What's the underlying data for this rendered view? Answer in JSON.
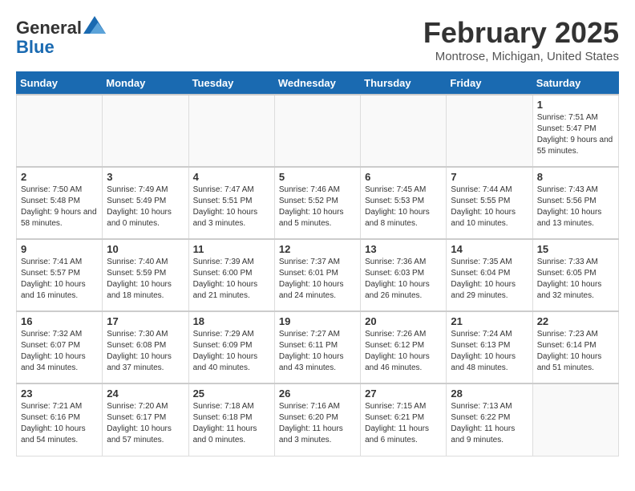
{
  "logo": {
    "general": "General",
    "blue": "Blue"
  },
  "header": {
    "title": "February 2025",
    "subtitle": "Montrose, Michigan, United States"
  },
  "days_of_week": [
    "Sunday",
    "Monday",
    "Tuesday",
    "Wednesday",
    "Thursday",
    "Friday",
    "Saturday"
  ],
  "weeks": [
    [
      {
        "day": "",
        "info": ""
      },
      {
        "day": "",
        "info": ""
      },
      {
        "day": "",
        "info": ""
      },
      {
        "day": "",
        "info": ""
      },
      {
        "day": "",
        "info": ""
      },
      {
        "day": "",
        "info": ""
      },
      {
        "day": "1",
        "info": "Sunrise: 7:51 AM\nSunset: 5:47 PM\nDaylight: 9 hours and 55 minutes."
      }
    ],
    [
      {
        "day": "2",
        "info": "Sunrise: 7:50 AM\nSunset: 5:48 PM\nDaylight: 9 hours and 58 minutes."
      },
      {
        "day": "3",
        "info": "Sunrise: 7:49 AM\nSunset: 5:49 PM\nDaylight: 10 hours and 0 minutes."
      },
      {
        "day": "4",
        "info": "Sunrise: 7:47 AM\nSunset: 5:51 PM\nDaylight: 10 hours and 3 minutes."
      },
      {
        "day": "5",
        "info": "Sunrise: 7:46 AM\nSunset: 5:52 PM\nDaylight: 10 hours and 5 minutes."
      },
      {
        "day": "6",
        "info": "Sunrise: 7:45 AM\nSunset: 5:53 PM\nDaylight: 10 hours and 8 minutes."
      },
      {
        "day": "7",
        "info": "Sunrise: 7:44 AM\nSunset: 5:55 PM\nDaylight: 10 hours and 10 minutes."
      },
      {
        "day": "8",
        "info": "Sunrise: 7:43 AM\nSunset: 5:56 PM\nDaylight: 10 hours and 13 minutes."
      }
    ],
    [
      {
        "day": "9",
        "info": "Sunrise: 7:41 AM\nSunset: 5:57 PM\nDaylight: 10 hours and 16 minutes."
      },
      {
        "day": "10",
        "info": "Sunrise: 7:40 AM\nSunset: 5:59 PM\nDaylight: 10 hours and 18 minutes."
      },
      {
        "day": "11",
        "info": "Sunrise: 7:39 AM\nSunset: 6:00 PM\nDaylight: 10 hours and 21 minutes."
      },
      {
        "day": "12",
        "info": "Sunrise: 7:37 AM\nSunset: 6:01 PM\nDaylight: 10 hours and 24 minutes."
      },
      {
        "day": "13",
        "info": "Sunrise: 7:36 AM\nSunset: 6:03 PM\nDaylight: 10 hours and 26 minutes."
      },
      {
        "day": "14",
        "info": "Sunrise: 7:35 AM\nSunset: 6:04 PM\nDaylight: 10 hours and 29 minutes."
      },
      {
        "day": "15",
        "info": "Sunrise: 7:33 AM\nSunset: 6:05 PM\nDaylight: 10 hours and 32 minutes."
      }
    ],
    [
      {
        "day": "16",
        "info": "Sunrise: 7:32 AM\nSunset: 6:07 PM\nDaylight: 10 hours and 34 minutes."
      },
      {
        "day": "17",
        "info": "Sunrise: 7:30 AM\nSunset: 6:08 PM\nDaylight: 10 hours and 37 minutes."
      },
      {
        "day": "18",
        "info": "Sunrise: 7:29 AM\nSunset: 6:09 PM\nDaylight: 10 hours and 40 minutes."
      },
      {
        "day": "19",
        "info": "Sunrise: 7:27 AM\nSunset: 6:11 PM\nDaylight: 10 hours and 43 minutes."
      },
      {
        "day": "20",
        "info": "Sunrise: 7:26 AM\nSunset: 6:12 PM\nDaylight: 10 hours and 46 minutes."
      },
      {
        "day": "21",
        "info": "Sunrise: 7:24 AM\nSunset: 6:13 PM\nDaylight: 10 hours and 48 minutes."
      },
      {
        "day": "22",
        "info": "Sunrise: 7:23 AM\nSunset: 6:14 PM\nDaylight: 10 hours and 51 minutes."
      }
    ],
    [
      {
        "day": "23",
        "info": "Sunrise: 7:21 AM\nSunset: 6:16 PM\nDaylight: 10 hours and 54 minutes."
      },
      {
        "day": "24",
        "info": "Sunrise: 7:20 AM\nSunset: 6:17 PM\nDaylight: 10 hours and 57 minutes."
      },
      {
        "day": "25",
        "info": "Sunrise: 7:18 AM\nSunset: 6:18 PM\nDaylight: 11 hours and 0 minutes."
      },
      {
        "day": "26",
        "info": "Sunrise: 7:16 AM\nSunset: 6:20 PM\nDaylight: 11 hours and 3 minutes."
      },
      {
        "day": "27",
        "info": "Sunrise: 7:15 AM\nSunset: 6:21 PM\nDaylight: 11 hours and 6 minutes."
      },
      {
        "day": "28",
        "info": "Sunrise: 7:13 AM\nSunset: 6:22 PM\nDaylight: 11 hours and 9 minutes."
      },
      {
        "day": "",
        "info": ""
      }
    ]
  ]
}
